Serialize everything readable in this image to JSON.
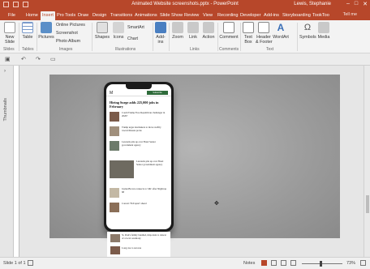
{
  "window": {
    "title": "Animated Website screenshots.pptx  -  PowerPoint",
    "user": "Lewis, Stephanie",
    "controls": [
      "–",
      "□",
      "✕"
    ]
  },
  "tabs": [
    {
      "label": "File"
    },
    {
      "label": "Home"
    },
    {
      "label": "Insert",
      "active": true
    },
    {
      "label": "Pro Tools"
    },
    {
      "label": "Draw"
    },
    {
      "label": "Design"
    },
    {
      "label": "Transitions"
    },
    {
      "label": "Animations"
    },
    {
      "label": "Slide Show"
    },
    {
      "label": "Review"
    },
    {
      "label": "View"
    },
    {
      "label": "Recording"
    },
    {
      "label": "Developer"
    },
    {
      "label": "Add-ins"
    },
    {
      "label": "Storyboarding"
    },
    {
      "label": "TookToo"
    }
  ],
  "tell_me": "Tell me",
  "ribbon": {
    "new_slide": "New\nSlide",
    "table": "Table",
    "pictures": "Pictures",
    "online_pictures": "Online Pictures",
    "screenshot": "Screenshot",
    "photo_album": "Photo Album",
    "shapes": "Shapes",
    "icons": "Icons",
    "smartart": "SmartArt",
    "chart": "Chart",
    "addins": "Add-\nins",
    "zoom": "Zoom",
    "link": "Link",
    "action": "Action",
    "comment": "Comment",
    "textbox": "Text\nBox",
    "header_footer": "Header\n& Footer",
    "wordart": "WordArt",
    "symbols": "Symbols",
    "media": "Media",
    "groups": {
      "slides": "Slides",
      "tables": "Tables",
      "images": "Images",
      "illustrations": "Illustrations",
      "links": "Links",
      "comments": "Comments",
      "text": "Text"
    }
  },
  "thumbnails_label": "Thumbnails",
  "phone_screen": {
    "masthead": "M",
    "subscribe": "Subscribe",
    "headline": "Hiring Surge adds 225,000 jobs in February",
    "articles": [
      "Could Trump Face Republican challenger in 2020?",
      "Trump urges lawmakers to move swiftly toward Russia probe",
      "Lawsuits pile up over Hotel Senior government agency"
    ],
    "feature": "Lawsuits pile up over Hotel Senior government agency",
    "more": [
      "Jaylen Brown connects to 'OK' after Nightcap 68",
      "Concert 'Fell apart' ahead"
    ],
    "overflow": [
      "St. Paul's family bundled, important to dancer of a local ceremony",
      "Long cue to success"
    ]
  },
  "status": {
    "slide": "Slide 1 of 1",
    "notes": "Notes",
    "zoom_pct": "73%"
  }
}
